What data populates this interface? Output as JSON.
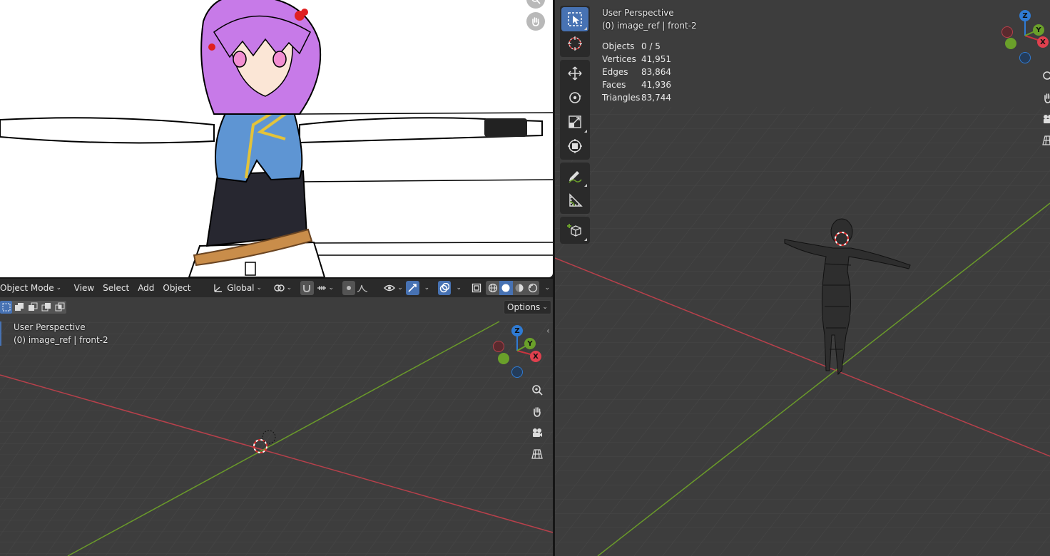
{
  "bottom_viewport": {
    "header": {
      "mode": "Object Mode",
      "menus": [
        "View",
        "Select",
        "Add",
        "Object"
      ],
      "transform_orientation": "Global"
    },
    "options_label": "Options",
    "overlay": {
      "line1": "User Perspective",
      "line2": "(0) image_ref | front-2"
    },
    "gizmo": {
      "x": "X",
      "y": "Y",
      "z": "Z"
    }
  },
  "right_viewport": {
    "overlay": {
      "line1": "User Perspective",
      "line2": "(0) image_ref | front-2"
    },
    "stats": [
      {
        "label": "Objects",
        "value": "0 / 5"
      },
      {
        "label": "Vertices",
        "value": "41,951"
      },
      {
        "label": "Edges",
        "value": "83,864"
      },
      {
        "label": "Faces",
        "value": "41,936"
      },
      {
        "label": "Triangles",
        "value": "83,744"
      }
    ],
    "toolbar_icons": [
      "select-box-icon",
      "cursor-icon",
      "move-icon",
      "rotate-icon",
      "scale-icon",
      "transform-icon",
      "annotate-icon",
      "measure-icon",
      "add-cube-icon"
    ],
    "gizmo": {
      "x": "X",
      "y": "Y",
      "z": "Z"
    }
  },
  "colors": {
    "viewport_bg": "#3d3d3d",
    "header_bg": "#2a2a2a",
    "active_blue": "#4772b3",
    "axis_red": "#c9343f",
    "axis_green": "#6aa02a",
    "axis_blue": "#2f7bd4"
  }
}
